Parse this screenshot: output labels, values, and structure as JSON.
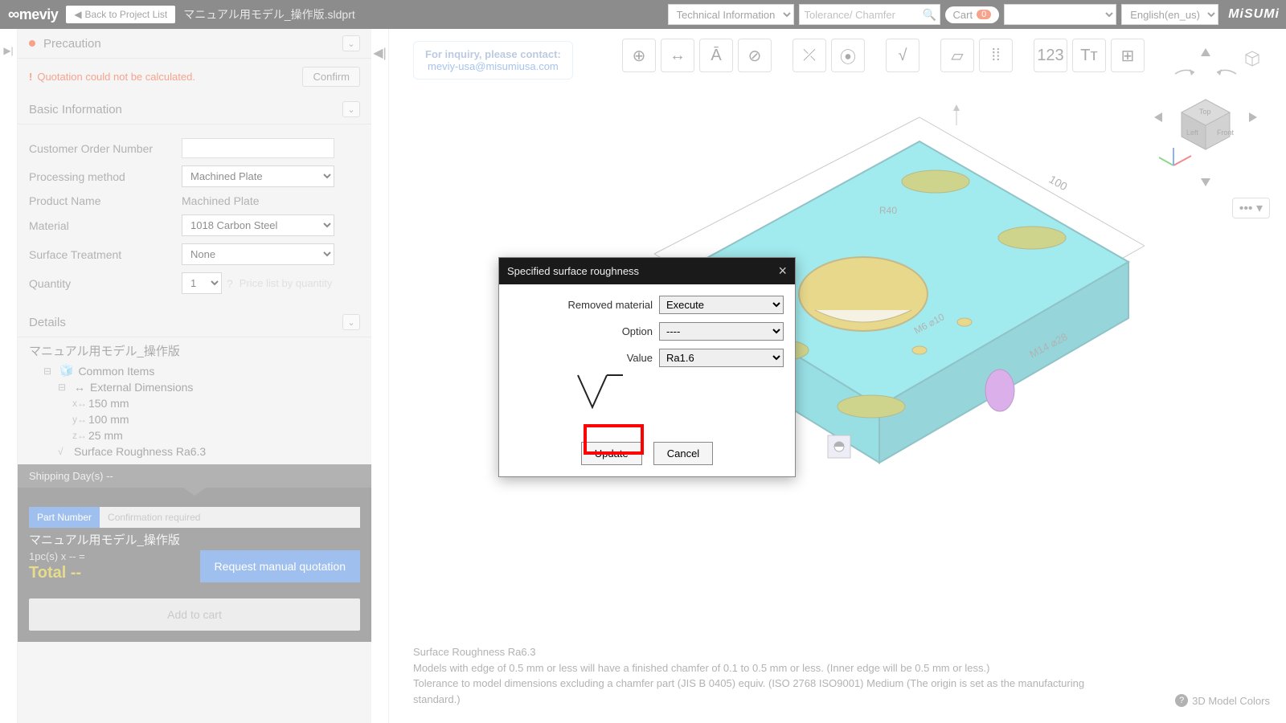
{
  "top": {
    "brand": "meviy",
    "back": "Back to Project List",
    "filename": "マニュアル用モデル_操作版.sldprt",
    "tech_dd": "Technical Information",
    "search_ph": "Tolerance/ Chamfer",
    "cart_label": "Cart",
    "cart_count": "0",
    "lang": "English(en_us)",
    "misumi": "MiSUMi"
  },
  "sidebar": {
    "precaution": "Precaution",
    "alert": "Quotation could not be calculated.",
    "confirm": "Confirm",
    "basic_info": "Basic Information",
    "fields": {
      "cust_order": "Customer Order Number",
      "proc_method": "Processing method",
      "proc_method_v": "Machined Plate",
      "product_name": "Product Name",
      "product_name_v": "Machined Plate",
      "material": "Material",
      "material_v": "1018 Carbon Steel",
      "surface": "Surface Treatment",
      "surface_v": "None",
      "quantity": "Quantity",
      "quantity_v": "1",
      "qty_link": "Price list by quantity"
    },
    "details": "Details",
    "tree": {
      "root": "マニュアル用モデル_操作版",
      "common": "Common Items",
      "extdim": "External Dimensions",
      "x": "150 mm",
      "y": "100 mm",
      "z": "25 mm",
      "rough": "Surface Roughness Ra6.3"
    },
    "ship": "Shipping Day(s) --",
    "pn_label": "Part Number",
    "pn_rest": "Confirmation required",
    "summary_title": "マニュアル用モデル_操作版",
    "pcs": "1pc(s)  x -- =",
    "total": "Total --",
    "req_quote": "Request manual quotation",
    "add_cart": "Add to cart"
  },
  "contact": {
    "l1": "For inquiry, please contact:",
    "l2": "meviy-usa@misumiusa.com"
  },
  "toolbar_icons": [
    "origin",
    "dimension",
    "tolerance",
    "cancel-dim",
    "hide-dim",
    "pmi",
    "roughness",
    "datum",
    "gdt",
    "note",
    "text",
    "views"
  ],
  "modal": {
    "title": "Specified surface roughness",
    "rm_label": "Removed material",
    "rm_value": "Execute",
    "opt_label": "Option",
    "opt_value": "----",
    "val_label": "Value",
    "val_value": "Ra1.6",
    "update": "Update",
    "cancel": "Cancel"
  },
  "footer": {
    "l1": "Surface Roughness Ra6.3",
    "l2": "Models with edge of 0.5 mm or less will have a finished chamfer of 0.1 to 0.5 mm or less. (Inner edge will be 0.5 mm or less.)",
    "l3": "Tolerance to model dimensions excluding a chamfer part (JIS B 0405) equiv. (ISO 2768 ISO9001) Medium (The origin is set as the manufacturing standard.)",
    "colors": "3D Model Colors"
  }
}
